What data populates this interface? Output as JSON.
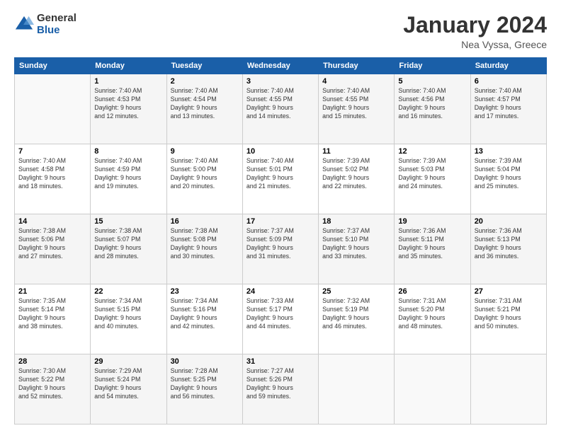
{
  "header": {
    "logo": {
      "general": "General",
      "blue": "Blue"
    },
    "title": "January 2024",
    "location": "Nea Vyssa, Greece"
  },
  "calendar": {
    "headers": [
      "Sunday",
      "Monday",
      "Tuesday",
      "Wednesday",
      "Thursday",
      "Friday",
      "Saturday"
    ],
    "rows": [
      [
        {
          "day": "",
          "info": ""
        },
        {
          "day": "1",
          "info": "Sunrise: 7:40 AM\nSunset: 4:53 PM\nDaylight: 9 hours\nand 12 minutes."
        },
        {
          "day": "2",
          "info": "Sunrise: 7:40 AM\nSunset: 4:54 PM\nDaylight: 9 hours\nand 13 minutes."
        },
        {
          "day": "3",
          "info": "Sunrise: 7:40 AM\nSunset: 4:55 PM\nDaylight: 9 hours\nand 14 minutes."
        },
        {
          "day": "4",
          "info": "Sunrise: 7:40 AM\nSunset: 4:55 PM\nDaylight: 9 hours\nand 15 minutes."
        },
        {
          "day": "5",
          "info": "Sunrise: 7:40 AM\nSunset: 4:56 PM\nDaylight: 9 hours\nand 16 minutes."
        },
        {
          "day": "6",
          "info": "Sunrise: 7:40 AM\nSunset: 4:57 PM\nDaylight: 9 hours\nand 17 minutes."
        }
      ],
      [
        {
          "day": "7",
          "info": "Sunrise: 7:40 AM\nSunset: 4:58 PM\nDaylight: 9 hours\nand 18 minutes."
        },
        {
          "day": "8",
          "info": "Sunrise: 7:40 AM\nSunset: 4:59 PM\nDaylight: 9 hours\nand 19 minutes."
        },
        {
          "day": "9",
          "info": "Sunrise: 7:40 AM\nSunset: 5:00 PM\nDaylight: 9 hours\nand 20 minutes."
        },
        {
          "day": "10",
          "info": "Sunrise: 7:40 AM\nSunset: 5:01 PM\nDaylight: 9 hours\nand 21 minutes."
        },
        {
          "day": "11",
          "info": "Sunrise: 7:39 AM\nSunset: 5:02 PM\nDaylight: 9 hours\nand 22 minutes."
        },
        {
          "day": "12",
          "info": "Sunrise: 7:39 AM\nSunset: 5:03 PM\nDaylight: 9 hours\nand 24 minutes."
        },
        {
          "day": "13",
          "info": "Sunrise: 7:39 AM\nSunset: 5:04 PM\nDaylight: 9 hours\nand 25 minutes."
        }
      ],
      [
        {
          "day": "14",
          "info": "Sunrise: 7:38 AM\nSunset: 5:06 PM\nDaylight: 9 hours\nand 27 minutes."
        },
        {
          "day": "15",
          "info": "Sunrise: 7:38 AM\nSunset: 5:07 PM\nDaylight: 9 hours\nand 28 minutes."
        },
        {
          "day": "16",
          "info": "Sunrise: 7:38 AM\nSunset: 5:08 PM\nDaylight: 9 hours\nand 30 minutes."
        },
        {
          "day": "17",
          "info": "Sunrise: 7:37 AM\nSunset: 5:09 PM\nDaylight: 9 hours\nand 31 minutes."
        },
        {
          "day": "18",
          "info": "Sunrise: 7:37 AM\nSunset: 5:10 PM\nDaylight: 9 hours\nand 33 minutes."
        },
        {
          "day": "19",
          "info": "Sunrise: 7:36 AM\nSunset: 5:11 PM\nDaylight: 9 hours\nand 35 minutes."
        },
        {
          "day": "20",
          "info": "Sunrise: 7:36 AM\nSunset: 5:13 PM\nDaylight: 9 hours\nand 36 minutes."
        }
      ],
      [
        {
          "day": "21",
          "info": "Sunrise: 7:35 AM\nSunset: 5:14 PM\nDaylight: 9 hours\nand 38 minutes."
        },
        {
          "day": "22",
          "info": "Sunrise: 7:34 AM\nSunset: 5:15 PM\nDaylight: 9 hours\nand 40 minutes."
        },
        {
          "day": "23",
          "info": "Sunrise: 7:34 AM\nSunset: 5:16 PM\nDaylight: 9 hours\nand 42 minutes."
        },
        {
          "day": "24",
          "info": "Sunrise: 7:33 AM\nSunset: 5:17 PM\nDaylight: 9 hours\nand 44 minutes."
        },
        {
          "day": "25",
          "info": "Sunrise: 7:32 AM\nSunset: 5:19 PM\nDaylight: 9 hours\nand 46 minutes."
        },
        {
          "day": "26",
          "info": "Sunrise: 7:31 AM\nSunset: 5:20 PM\nDaylight: 9 hours\nand 48 minutes."
        },
        {
          "day": "27",
          "info": "Sunrise: 7:31 AM\nSunset: 5:21 PM\nDaylight: 9 hours\nand 50 minutes."
        }
      ],
      [
        {
          "day": "28",
          "info": "Sunrise: 7:30 AM\nSunset: 5:22 PM\nDaylight: 9 hours\nand 52 minutes."
        },
        {
          "day": "29",
          "info": "Sunrise: 7:29 AM\nSunset: 5:24 PM\nDaylight: 9 hours\nand 54 minutes."
        },
        {
          "day": "30",
          "info": "Sunrise: 7:28 AM\nSunset: 5:25 PM\nDaylight: 9 hours\nand 56 minutes."
        },
        {
          "day": "31",
          "info": "Sunrise: 7:27 AM\nSunset: 5:26 PM\nDaylight: 9 hours\nand 59 minutes."
        },
        {
          "day": "",
          "info": ""
        },
        {
          "day": "",
          "info": ""
        },
        {
          "day": "",
          "info": ""
        }
      ]
    ]
  }
}
